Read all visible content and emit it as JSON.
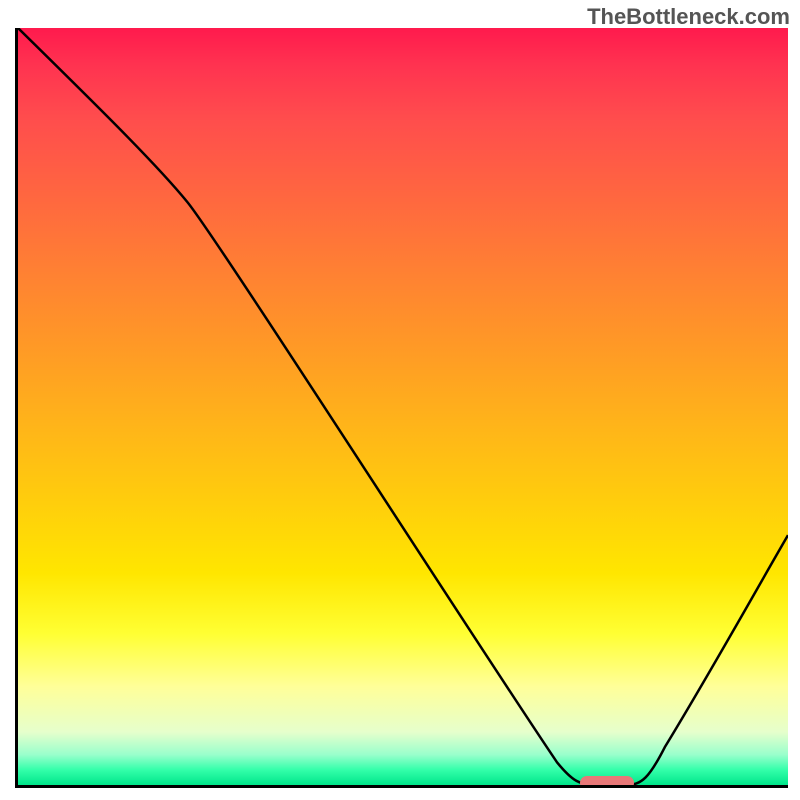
{
  "watermark": "TheBottleneck.com",
  "chart_data": {
    "type": "line",
    "title": "",
    "xlabel": "",
    "ylabel": "",
    "xlim": [
      0,
      100
    ],
    "ylim": [
      0,
      100
    ],
    "x": [
      0,
      22,
      70,
      75,
      79,
      100
    ],
    "values": [
      100,
      77,
      3,
      0,
      0,
      33
    ],
    "marker": {
      "x_start": 73,
      "x_end": 80,
      "y": 0
    },
    "gradient_stops": [
      {
        "pos": 0,
        "color": "#ff1a4d"
      },
      {
        "pos": 50,
        "color": "#ffb300"
      },
      {
        "pos": 85,
        "color": "#ffff66"
      },
      {
        "pos": 100,
        "color": "#00e68a"
      }
    ]
  }
}
